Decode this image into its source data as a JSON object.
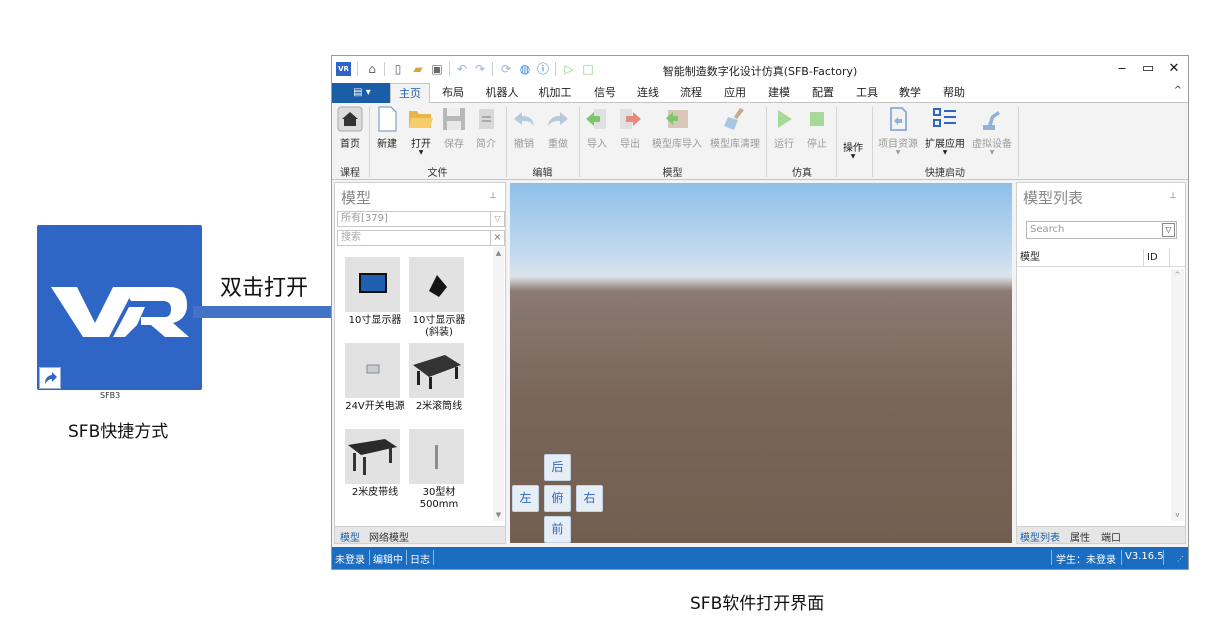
{
  "illustration": {
    "shortcut_file_name": "SFB3",
    "shortcut_caption": "SFB快捷方式",
    "action_text": "双击打开",
    "window_caption": "SFB软件打开界面",
    "logo_text": "VR"
  },
  "window": {
    "title": "智能制造数字化设计仿真(SFB-Factory)",
    "app_icon_text": "VR",
    "controls": {
      "minimize": "‒",
      "maximize": "▭",
      "close": "✕"
    }
  },
  "menu": {
    "file_button": "▤ ▾",
    "items": [
      "主页",
      "布局",
      "机器人",
      "机加工",
      "信号",
      "连线",
      "流程",
      "应用",
      "建模",
      "配置",
      "工具",
      "教学",
      "帮助"
    ],
    "active_index": 0,
    "collapse_glyph": "^"
  },
  "ribbon": {
    "buttons": {
      "home": "首页",
      "new": "新建",
      "open": "打开",
      "save": "保存",
      "intro": "简介",
      "undo": "撤销",
      "redo": "重做",
      "import": "导入",
      "export": "导出",
      "lib_import": "模型库导入",
      "lib_clean": "模型库清理",
      "run": "运行",
      "stop": "停止",
      "operate": "操作",
      "project_res": "项目资源",
      "ext_apps": "扩展应用",
      "virtual_dev": "虚拟设备"
    },
    "groups": {
      "course": "课程",
      "file": "文件",
      "edit": "编辑",
      "model": "模型",
      "sim": "仿真",
      "quick": "快捷启动"
    }
  },
  "left_panel": {
    "title": "模型",
    "filter_value": "所有[379]",
    "search_placeholder": "搜索",
    "models": [
      {
        "label": "10寸显示器"
      },
      {
        "label": "10寸显示器(斜装)"
      },
      {
        "label": "24V开关电源"
      },
      {
        "label": "2米滚筒线"
      },
      {
        "label": "2米皮带线"
      },
      {
        "label": "30型材500mm"
      }
    ],
    "tabs": [
      "模型",
      "网络模型"
    ]
  },
  "viewport": {
    "view_buttons": {
      "back": "后",
      "left": "左",
      "top": "俯",
      "right": "右",
      "front": "前"
    }
  },
  "right_panel": {
    "title": "模型列表",
    "search_placeholder": "Search",
    "columns": [
      "模型",
      "ID"
    ],
    "tabs": [
      "模型列表",
      "属性",
      "端口"
    ]
  },
  "status": {
    "left_items": [
      "未登录",
      "编辑中",
      "日志"
    ],
    "user": "学生：未登录",
    "version": "V3.16.5"
  },
  "colors": {
    "brand_blue": "#2f66c6",
    "status_blue": "#1a6dc0",
    "file_button": "#1a5ea8"
  }
}
